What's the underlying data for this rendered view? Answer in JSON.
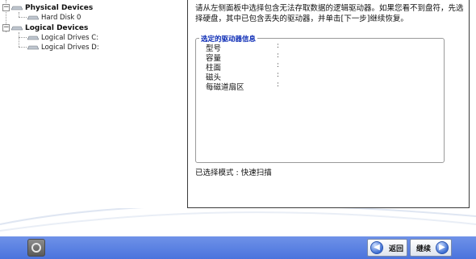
{
  "tree": {
    "physical_devices": "Physical Devices",
    "hard_disk": "Hard Disk 0",
    "logical_devices": "Logical Devices",
    "drive_c": "Logical Drives C:",
    "drive_d": "Logical Drives D:"
  },
  "right": {
    "instructions": "请从左侧面板中选择包含无法存取数据的逻辑驱动器。如果您看不到盘符，先选择硬盘，其中已包含丢失的驱动器，并单击[下一步]继续恢复。",
    "group_title": "选定的驱动器信息",
    "fields": [
      {
        "label": "型号",
        "sep": ":"
      },
      {
        "label": "容量",
        "sep": ":"
      },
      {
        "label": "柱面",
        "sep": ":"
      },
      {
        "label": "磁头",
        "sep": ":"
      },
      {
        "label": "每磁道扇区",
        "sep": ":"
      }
    ],
    "mode_text": "已选择模式 : 快速扫描"
  },
  "bottom": {
    "back_label": "返回",
    "continue_label": "继续",
    "back_icon": "arrow-left-icon",
    "continue_icon": "arrow-right-icon",
    "help_icon": "help-ring-icon"
  },
  "colors": {
    "bar_top": "#6f92e8",
    "bar_bottom": "#4a73dd",
    "group_title": "#0b2bb5"
  }
}
